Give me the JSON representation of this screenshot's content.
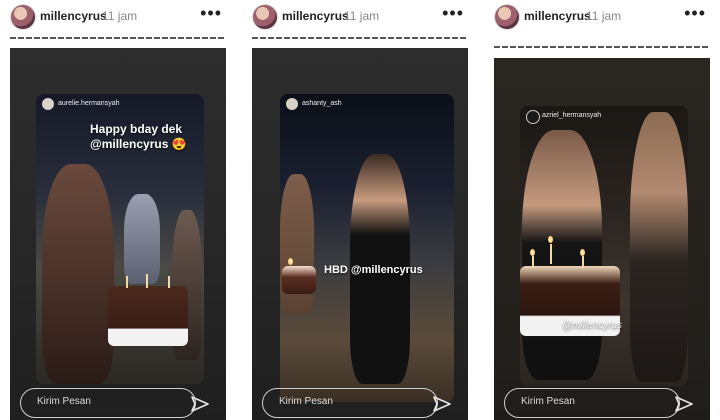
{
  "stories": [
    {
      "username": "millencyrus",
      "time": "11 jam",
      "card_username": "aurelie.hermansyah",
      "overlay_text": "Happy bday dek\n@millencyrus 😍",
      "reply_placeholder": "Kirim Pesan"
    },
    {
      "username": "millencyrus",
      "time": "11 jam",
      "card_username": "ashanty_ash",
      "overlay_text": "HBD @millencyrus",
      "reply_placeholder": "Kirim Pesan"
    },
    {
      "username": "millencyrus",
      "time": "11 jam",
      "card_username": "azriel_hermansyah",
      "overlay_text": "@millencyrus",
      "reply_placeholder": "Kirim Pesan"
    }
  ]
}
